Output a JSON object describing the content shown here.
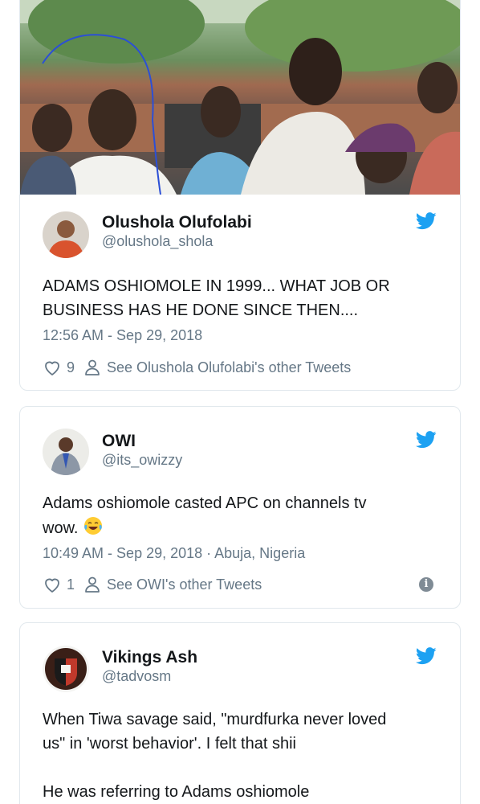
{
  "tweets": [
    {
      "author_name": "Olushola Olufolabi",
      "handle": "@olushola_shola",
      "text": "ADAMS OSHIOMOLE IN 1999... WHAT JOB OR BUSINESS HAS HE DONE SINCE THEN....",
      "timestamp": "12:56 AM - Sep 29, 2018",
      "likes": "9",
      "other_tweets_label": "See Olushola Olufolabi's other Tweets",
      "has_photo": true
    },
    {
      "author_name": "OWI",
      "handle": "@its_owizzy",
      "text_line1": "Adams oshiomole casted APC on channels tv",
      "text_line2": "wow.",
      "emoji": "face-with-tears-of-joy",
      "timestamp": "10:49 AM - Sep 29, 2018 · Abuja, Nigeria",
      "likes": "1",
      "other_tweets_label": "See OWI's other Tweets"
    },
    {
      "author_name": "Vikings Ash",
      "handle": "@tadvosm",
      "text_line1": "When Tiwa savage said, \"murdfurka never loved",
      "text_line2": "us\" in 'worst behavior'. I felt that shii",
      "text_line3": "He was referring to Adams oshiomole"
    }
  ],
  "icons": {
    "brand": "twitter-bird-icon",
    "like": "heart-icon",
    "profile": "person-icon",
    "info": "info-icon"
  },
  "colors": {
    "twitter_blue": "#1da1f2",
    "text_primary": "#14171a",
    "text_secondary": "#657786",
    "border": "#e1e8ed"
  }
}
